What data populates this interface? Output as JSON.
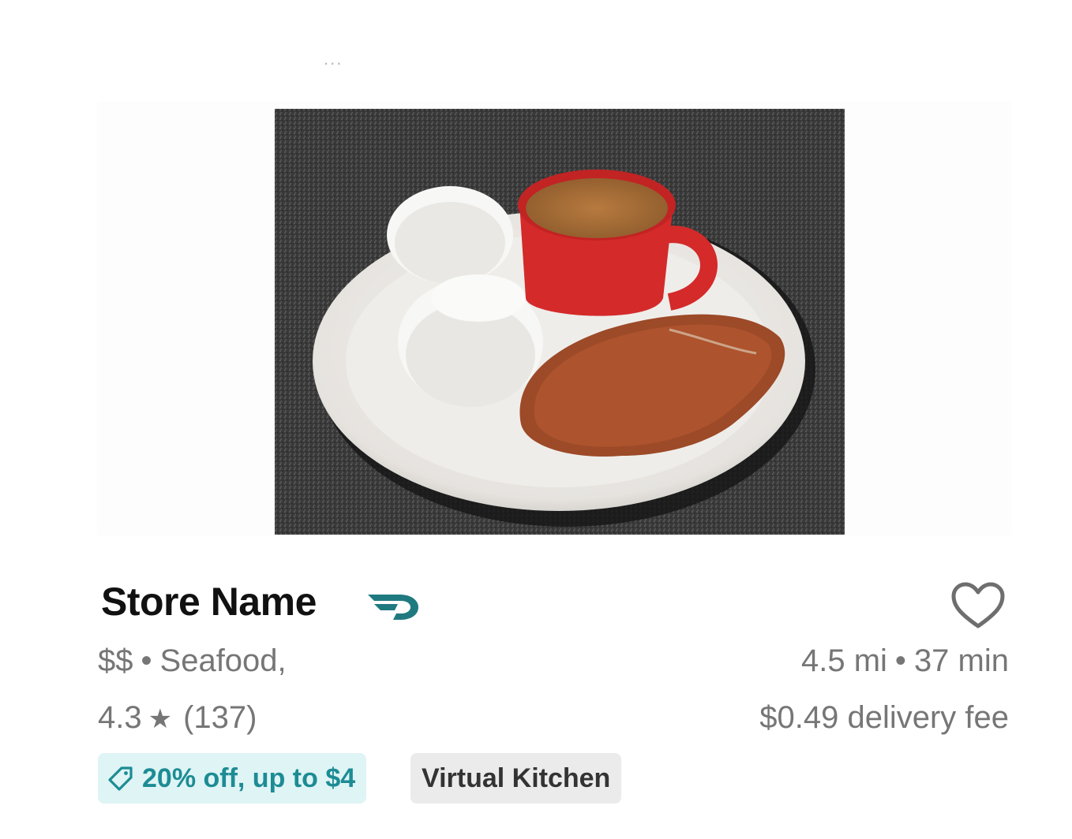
{
  "header": {
    "overflow_dots": "..."
  },
  "store": {
    "name": "Store Name",
    "price_range": "$$",
    "separator": "•",
    "cuisine": "Seafood,",
    "rating": "4.3",
    "star_icon": "star-icon",
    "review_count": "(137)",
    "distance": "4.5 mi",
    "time": "37 min",
    "delivery_fee": "$0.49 delivery fee"
  },
  "badges": {
    "promo": "20% off, up to $4",
    "virtual_kitchen": "Virtual Kitchen"
  },
  "icons": {
    "dashpass": "dashpass-icon",
    "favorite": "heart-icon",
    "promo_tag": "tag-icon"
  },
  "colors": {
    "promo_text": "#1c8c94",
    "promo_bg": "#dff4f5",
    "dashpass": "#1f7a80",
    "meta_text": "#767676"
  }
}
